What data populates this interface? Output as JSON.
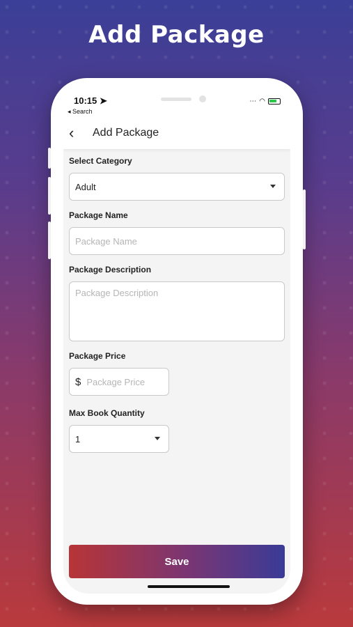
{
  "headline": "Add Package",
  "status": {
    "time": "10:15",
    "back_label": "◂ Search"
  },
  "nav": {
    "title": "Add Package"
  },
  "form": {
    "category": {
      "label": "Select Category",
      "value": "Adult"
    },
    "package_name": {
      "label": "Package Name",
      "placeholder": "Package Name"
    },
    "package_description": {
      "label": "Package Description",
      "placeholder": "Package Description"
    },
    "package_price": {
      "label": "Package Price",
      "currency": "$",
      "placeholder": "Package Price"
    },
    "max_book_quantity": {
      "label": "Max Book Quantity",
      "value": "1"
    }
  },
  "save_label": "Save",
  "colors": {
    "gradient_start": "#b73536",
    "gradient_end": "#3a3b97"
  }
}
